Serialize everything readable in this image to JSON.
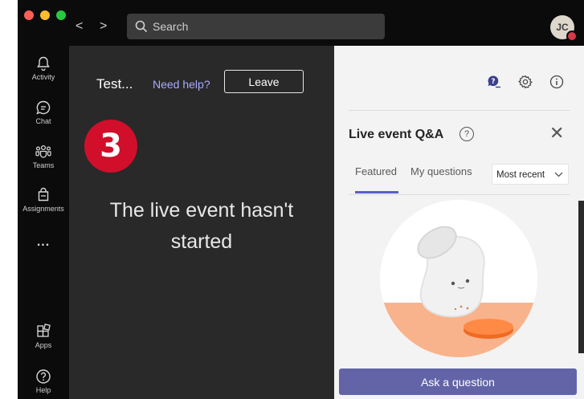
{
  "window": {
    "traffic_colors": [
      "#ff5f57",
      "#febc2e",
      "#28c840"
    ]
  },
  "topbar": {
    "back_glyph": "<",
    "forward_glyph": ">",
    "search_placeholder": "Search",
    "avatar_initials": "JC",
    "presence_color": "#d33a4a"
  },
  "rail": {
    "items": [
      {
        "label": "Activity",
        "icon": "bell-icon"
      },
      {
        "label": "Chat",
        "icon": "chat-icon"
      },
      {
        "label": "Teams",
        "icon": "teams-icon"
      },
      {
        "label": "Assignments",
        "icon": "assignments-icon"
      },
      {
        "label": "...",
        "icon": "more-icon"
      },
      {
        "label": "Apps",
        "icon": "apps-icon"
      },
      {
        "label": "Help",
        "icon": "help-icon"
      }
    ]
  },
  "stage": {
    "event_title": "Test...",
    "help_link": "Need help?",
    "leave_label": "Leave",
    "step_number": "3",
    "status_line1": "The live event hasn't",
    "status_line2": "started"
  },
  "panel": {
    "title": "Live event Q&A",
    "help_glyph": "?",
    "close_glyph": "✕",
    "tabs": [
      {
        "label": "Featured",
        "selected": true
      },
      {
        "label": "My questions",
        "selected": false
      }
    ],
    "sort_value": "Most recent",
    "ask_label": "Ask a question",
    "accent_color": "#6264a7"
  }
}
